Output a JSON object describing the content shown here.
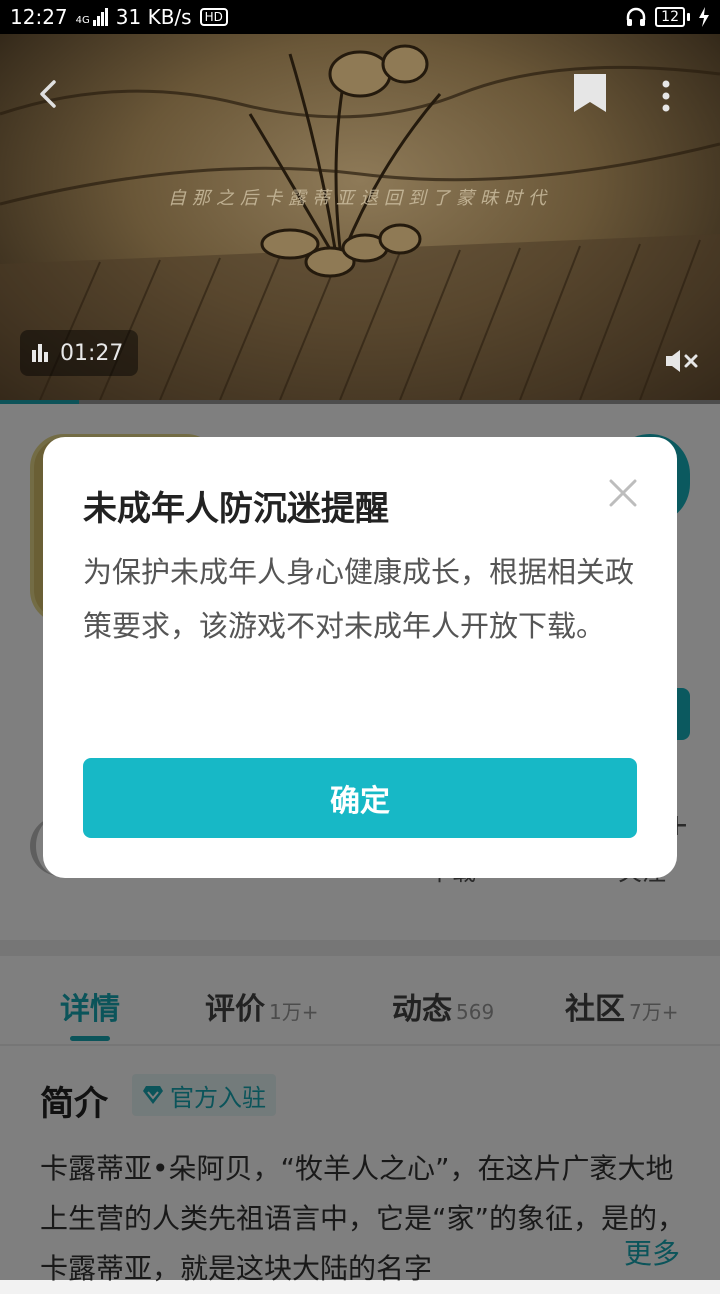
{
  "status_bar": {
    "time": "12:27",
    "network": "4G",
    "speed": "31 KB/s",
    "hd": "HD",
    "battery": "12"
  },
  "video": {
    "subtitle": "自那之后卡露蒂亚退回到了蒙昧时代",
    "duration": "01:27",
    "progress": 0.11,
    "icons": [
      "back-icon",
      "bookmark-icon",
      "more-icon",
      "audio-bars-icon",
      "mute-icon"
    ]
  },
  "page": {
    "stats": {
      "download_label": "下载",
      "follow_label": "关注"
    },
    "tabs": [
      {
        "label": "详情",
        "count": ""
      },
      {
        "label": "评价",
        "count": "1万+"
      },
      {
        "label": "动态",
        "count": "569"
      },
      {
        "label": "社区",
        "count": "7万+"
      }
    ],
    "intro": {
      "title": "简介",
      "badge": "官方入驻",
      "text": "卡露蒂亚•朵阿贝，“牧羊人之心”，在这片广袤大地上生营的人类先祖语言中，它是“家”的象征，是的，卡露蒂亚，就是这块大陆的名字",
      "more": "更多"
    }
  },
  "dialog": {
    "title": "未成年人防沉迷提醒",
    "message": "为保护未成年人身心健康成长，根据相关政策要求，该游戏不对未成年人开放下载。",
    "confirm_label": "确定"
  },
  "colors": {
    "accent": "#17b8c6",
    "overlay": "rgba(0,0,0,0.5)"
  }
}
